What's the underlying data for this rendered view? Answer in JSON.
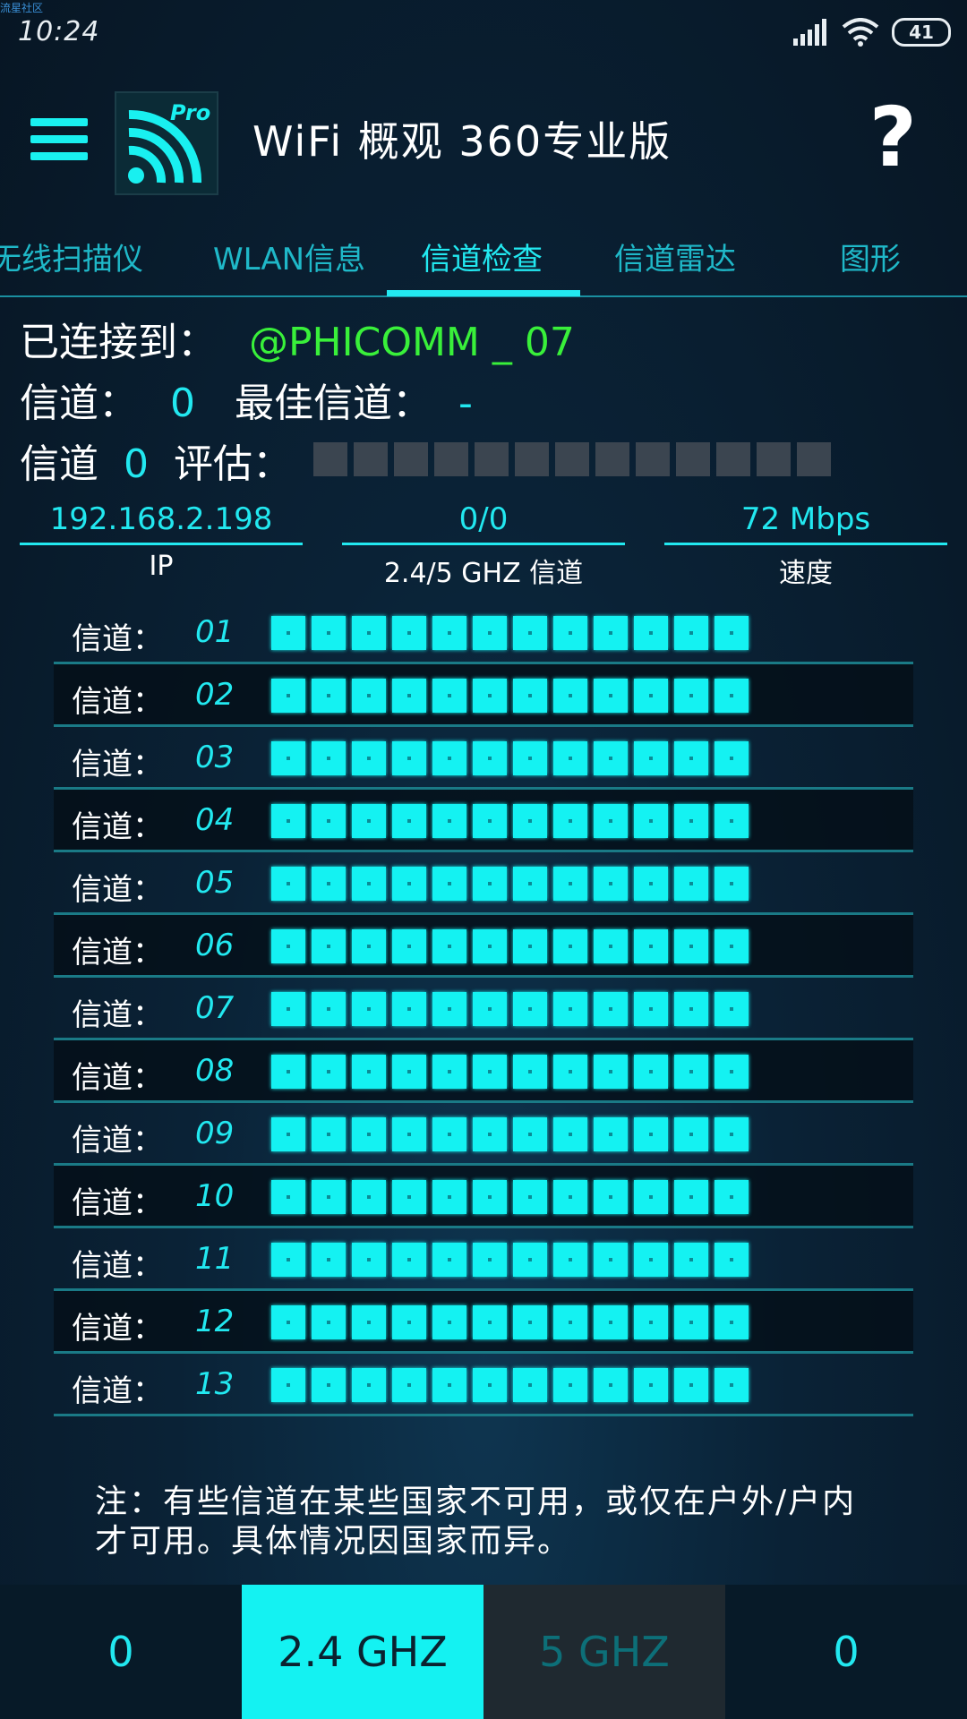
{
  "watermark": "流星社区",
  "status_bar": {
    "time": "10:24",
    "battery": "41",
    "signal_icon": "cell-signal-icon",
    "wifi_icon": "wifi-icon"
  },
  "app_bar": {
    "title": "WiFi 概观 360专业版",
    "help": "?",
    "logo_badge": "Pro"
  },
  "tabs": [
    {
      "label": "无线扫描仪"
    },
    {
      "label": "WLAN信息"
    },
    {
      "label": "信道检查",
      "active": true
    },
    {
      "label": "信道雷达"
    },
    {
      "label": "图形"
    }
  ],
  "connection": {
    "connected_label": "已连接到：",
    "ssid": "@PHICOMM _ 07",
    "channel_label": "信道：",
    "channel_value": "0",
    "best_channel_label": "最佳信道：",
    "best_channel_value": "-",
    "rating_prefix": "信道",
    "rating_channel": "0",
    "rating_suffix": "评估：",
    "rating_level": 0
  },
  "stats": [
    {
      "value": "192.168.2.198",
      "label": "IP"
    },
    {
      "value": "0/0",
      "label": "2.4/5 GHZ 信道"
    },
    {
      "value": "72 Mbps",
      "label": "速度"
    }
  ],
  "channels": [
    {
      "label": "信道：",
      "num": "01",
      "level": 1
    },
    {
      "label": "信道：",
      "num": "02",
      "level": 1
    },
    {
      "label": "信道：",
      "num": "03",
      "level": 1
    },
    {
      "label": "信道：",
      "num": "04",
      "level": 1
    },
    {
      "label": "信道：",
      "num": "05",
      "level": 1
    },
    {
      "label": "信道：",
      "num": "06",
      "level": 1
    },
    {
      "label": "信道：",
      "num": "07",
      "level": 1
    },
    {
      "label": "信道：",
      "num": "08",
      "level": 1
    },
    {
      "label": "信道：",
      "num": "09",
      "level": 1
    },
    {
      "label": "信道：",
      "num": "10",
      "level": 1
    },
    {
      "label": "信道：",
      "num": "11",
      "level": 1
    },
    {
      "label": "信道：",
      "num": "12",
      "level": 1
    },
    {
      "label": "信道：",
      "num": "13",
      "level": 1
    }
  ],
  "note": "注：有些信道在某些国家不可用，或仅在户外/户内才可用。具体情况因国家而异。",
  "bottom_bar": [
    {
      "label": "0"
    },
    {
      "label": "2.4 GHZ",
      "selected": true
    },
    {
      "label": "5 GHZ"
    },
    {
      "label": "0"
    }
  ],
  "colors": {
    "accent": "#22e8f0",
    "ssid": "#39f03a",
    "background": "#0a2236",
    "box_empty": "#3b4550"
  }
}
